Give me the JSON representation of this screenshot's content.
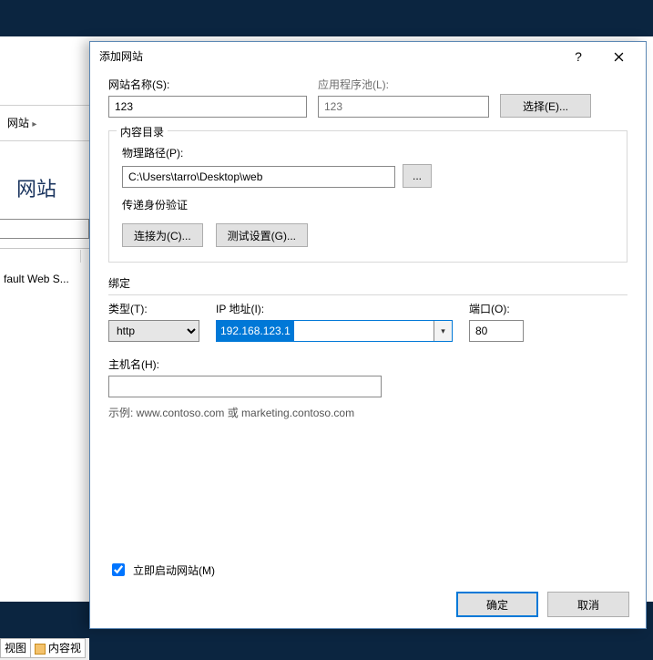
{
  "bg": {
    "breadcrumb_label": "网站",
    "panel_title": "网站",
    "site_item": "fault Web S...",
    "tab_view": "视图",
    "tab_content": "内容视"
  },
  "dialog": {
    "title": "添加网站",
    "help": "?",
    "site_name_label": "网站名称(S):",
    "site_name_value": "123",
    "app_pool_label": "应用程序池(L):",
    "app_pool_value": "123",
    "select_button": "选择(E)...",
    "content_group": "内容目录",
    "physical_path_label": "物理路径(P):",
    "physical_path_value": "C:\\Users\\tarro\\Desktop\\web",
    "browse_button": "...",
    "passthrough_label": "传递身份验证",
    "connect_as_button": "连接为(C)...",
    "test_settings_button": "测试设置(G)...",
    "binding_group": "绑定",
    "type_label": "类型(T):",
    "type_value": "http",
    "ip_label": "IP 地址(I):",
    "ip_value": "192.168.123.1",
    "port_label": "端口(O):",
    "port_value": "80",
    "host_label": "主机名(H):",
    "host_value": "",
    "example_text": "示例: www.contoso.com 或 marketing.contoso.com",
    "start_now_label": "立即启动网站(M)",
    "ok_button": "确定",
    "cancel_button": "取消"
  }
}
